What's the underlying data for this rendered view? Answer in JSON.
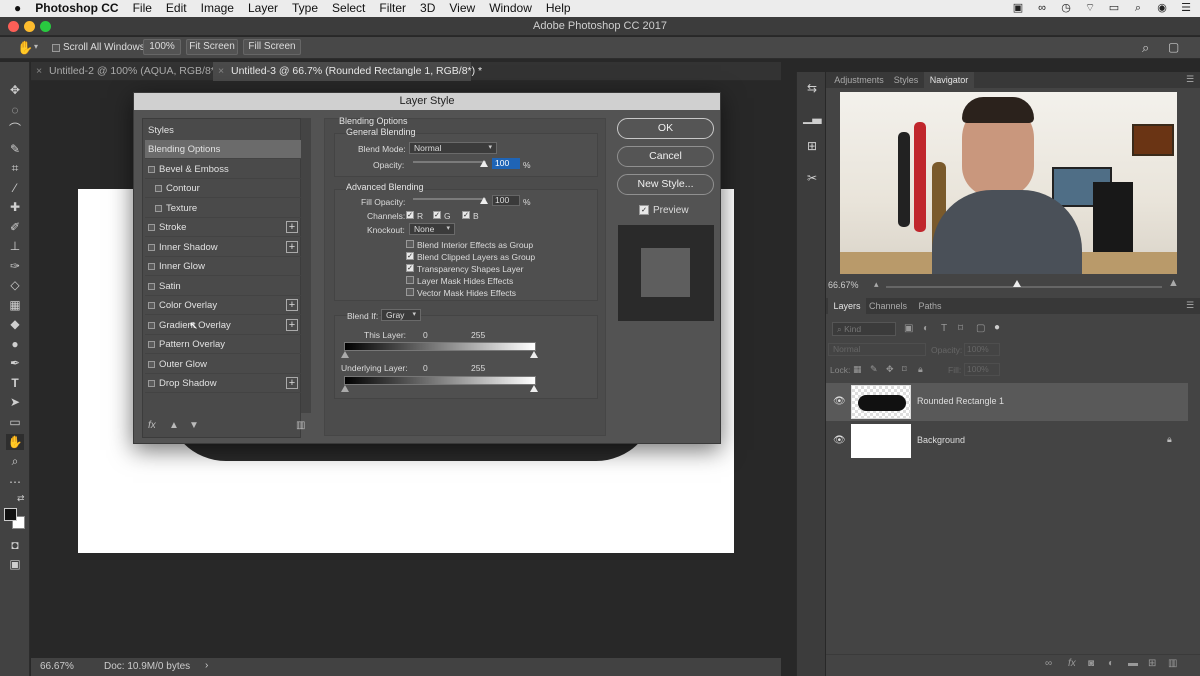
{
  "menubar": {
    "apple": "",
    "app_name": "Photoshop CC",
    "items": [
      "File",
      "Edit",
      "Image",
      "Layer",
      "Type",
      "Select",
      "Filter",
      "3D",
      "View",
      "Window",
      "Help"
    ]
  },
  "window": {
    "title": "Adobe Photoshop CC 2017"
  },
  "options": {
    "scroll_all_windows": "Scroll All Windows",
    "zoom_100": "100%",
    "fit_screen": "Fit Screen",
    "fill_screen": "Fill Screen"
  },
  "tabs": [
    {
      "label": "Untitled-2 @ 100% (AQUA, RGB/8*) *"
    },
    {
      "label": "Untitled-3 @ 66.7% (Rounded Rectangle 1, RGB/8*) *"
    }
  ],
  "status": {
    "zoom": "66.67%",
    "doc": "Doc: 10.9M/0 bytes",
    "arrow": "›"
  },
  "dialog": {
    "title": "Layer Style",
    "styles_header": "Styles",
    "style_items": [
      {
        "label": "Blending Options"
      },
      {
        "label": "Bevel & Emboss"
      },
      {
        "label": "Contour"
      },
      {
        "label": "Texture"
      },
      {
        "label": "Stroke"
      },
      {
        "label": "Inner Shadow"
      },
      {
        "label": "Inner Glow"
      },
      {
        "label": "Satin"
      },
      {
        "label": "Color Overlay"
      },
      {
        "label": "Gradient Overlay"
      },
      {
        "label": "Pattern Overlay"
      },
      {
        "label": "Outer Glow"
      },
      {
        "label": "Drop Shadow"
      }
    ],
    "fx": "fx",
    "blending_options": "Blending Options",
    "general_blending": "General Blending",
    "blend_mode_label": "Blend Mode:",
    "blend_mode_value": "Normal",
    "opacity_label": "Opacity:",
    "opacity_value": "100",
    "pct": "%",
    "advanced_blending": "Advanced Blending",
    "fill_opacity_label": "Fill Opacity:",
    "fill_opacity_value": "100",
    "channels_label": "Channels:",
    "channel_r": "R",
    "channel_g": "G",
    "channel_b": "B",
    "knockout_label": "Knockout:",
    "knockout_value": "None",
    "options": [
      {
        "label": "Blend Interior Effects as Group",
        "checked": false
      },
      {
        "label": "Blend Clipped Layers as Group",
        "checked": true
      },
      {
        "label": "Transparency Shapes Layer",
        "checked": true
      },
      {
        "label": "Layer Mask Hides Effects",
        "checked": false
      },
      {
        "label": "Vector Mask Hides Effects",
        "checked": false
      }
    ],
    "blend_if_label": "Blend If:",
    "blend_if_value": "Gray",
    "this_layer_label": "This Layer:",
    "this_layer_min": "0",
    "this_layer_max": "255",
    "underlying_label": "Underlying Layer:",
    "underlying_min": "0",
    "underlying_max": "255",
    "ok": "OK",
    "cancel": "Cancel",
    "new_style": "New Style...",
    "preview": "Preview"
  },
  "panels": {
    "top_tabs": [
      "Adjustments",
      "Styles",
      "Navigator"
    ],
    "nav_zoom": "66.67%",
    "layer_tabs": [
      "Layers",
      "Channels",
      "Paths"
    ],
    "kind": "Kind",
    "blend": "Normal",
    "opacity_label": "Opacity:",
    "opacity_value": "100%",
    "lock_label": "Lock:",
    "fill_label": "Fill:",
    "fill_value": "100%",
    "layers": [
      {
        "name": "Rounded Rectangle 1"
      },
      {
        "name": "Background"
      }
    ]
  },
  "colors": {
    "accent": "#1f64b5",
    "selection": "#6b6b6b"
  }
}
